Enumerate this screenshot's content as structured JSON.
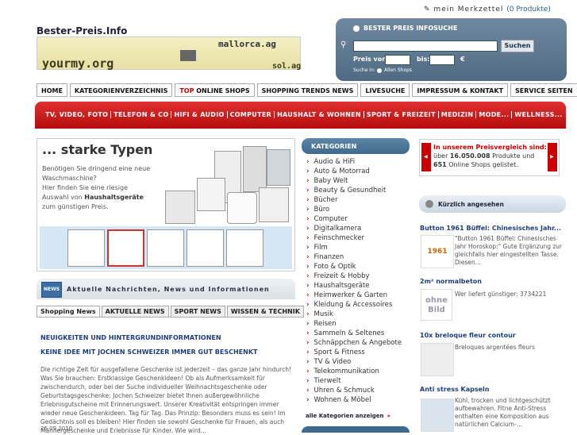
{
  "site": {
    "logo": "Bester-Preis.Info",
    "merkzettel": "mein Merkzettel",
    "merkzettel_count": "(0 Produkte)"
  },
  "banner": {
    "top": "mallorca.ag",
    "main": "yourmy.org",
    "right": "sol.ag"
  },
  "search": {
    "title": "BESTER PREIS INFOSUCHE",
    "button": "Suchen",
    "preis_von": "Preis von:",
    "bis": "bis:",
    "currency": "€",
    "suche_in": "Suche in:",
    "alle_shops": "Allen Shops"
  },
  "nav": [
    "HOME",
    "KATEGORIENVERZEICHNIS",
    "TOP ONLINE SHOPS",
    "SHOPPING TRENDS NEWS",
    "LIVESUCHE",
    "IMPRESSUM & KONTAKT",
    "SERVICE SEITEN"
  ],
  "nav_top_prefix": "TOP",
  "nav_top_rest": " ONLINE SHOPS",
  "redbar": [
    "TV, VIDEO, FOTO",
    "TELEFON & CO",
    "HIFI & AUDIO",
    "COMPUTER",
    "HAUSHALT & WOHNEN",
    "SPORT & FREIZEIT",
    "MEDIZIN",
    "MODE...",
    "WELLNESS..."
  ],
  "hero": {
    "title": "... starke Typen",
    "text1": "Benötigen Sie dringend eine neue Waschmaschine?",
    "text2": "Hier finden Sie eine riesige Auswahl von",
    "text2_bold": "Haushaltsgeräte",
    "text2_end": "zum günstigen Preis."
  },
  "news": {
    "icon": "NEWS",
    "heading": "Aktuelle Nachrichten, News und Informationen",
    "tabs": [
      "Shopping News",
      "AKTUELLE NEWS",
      "SPORT NEWS",
      "WISSEN & TECHNIK"
    ],
    "headline1": "NEUIGKEITEN UND HINTERGRUNDINFORMATIONEN",
    "headline2": "KEINE IDEE MIT JOCHEN SCHWEIZER IMMER GUT BESCHENKT",
    "text": "Die richtige Zeit für ausgefallene Geschenke ist jederzeit – das ganze Jahr hindurch! Was Sie brauchen: Erstklassige Geschenkideen! Ob als Aufmerksamkeit für zwischendurch, oder bei der Suche individueller Weihnachtsgeschenke oder Geburtstagsgeschenke: Jochen Schweizer bietet Ihnen außergewöhnliche Erlebnisgutscheine mit Erinnerungswert. Unserer Kreativität entspringen immer wieder neue Geschenkideen. Tag für Tag. Das Prinzip: Besonders muss es sein! Im Gedächtnis soll es bleiben! Hier finden sie sowohl Geschenke für Frauen, als auch Männergeschenke und Erlebnisse für Kinder. Wie wird...",
    "date": "25.09.2010"
  },
  "categories": {
    "heading": "KATEGORIEN",
    "items": [
      "Audio & HiFi",
      "Auto & Motorrad",
      "Baby Welt",
      "Beauty & Gesundheit",
      "Bücher",
      "Büro",
      "Computer",
      "Digitalkamera",
      "Feinschmecker",
      "Film",
      "Finanzen",
      "Foto & Optik",
      "Freizeit & Hobby",
      "Haushaltsgeräte",
      "Heimwerker & Garten",
      "Kleidung & Accessoires",
      "Musik",
      "Reisen",
      "Sammeln & Seltenes",
      "Schnäppchen & Angebote",
      "Sport & Fitness",
      "TV & Video",
      "Telekommunikation",
      "Tierwelt",
      "Uhren & Schmuck",
      "Wohnen & Möbel"
    ],
    "more": "alle Kategorien anzeigen",
    "more_arrow": "»"
  },
  "info": {
    "red": "In unserem Preisvergleich sind:",
    "t1": "über",
    "count1": "16.050.008",
    "t2": "Produkte und",
    "count2": "651",
    "t3": "Online Shops gelistet."
  },
  "recent": {
    "heading": "Kürzlich angesehen",
    "items": [
      {
        "title": "Button 1961 Büffel: Chinesisches Jahr...",
        "desc": "\"Button 1961 Büffel: Chinesisches Jahr Horoskop:\" Gute Ergänzung zur gleichfalls hier eingestellten Tasse. Diesen...",
        "img": "1961"
      },
      {
        "title": "2m² normalbeton",
        "desc": "Wer liefert günstiger: 3734221",
        "img": "ohne Bild"
      },
      {
        "title": "10x breloque fleur contour",
        "desc": "Breloques argentées fleurs",
        "img": ""
      },
      {
        "title": "Anti stress Kapseln",
        "desc": "Kühl, trocken und lichtgeschützt aufbewahren. Fitne Anti-Stress enthalten eine Komposition aus natürlichen Calcium-...",
        "img": ""
      }
    ]
  }
}
